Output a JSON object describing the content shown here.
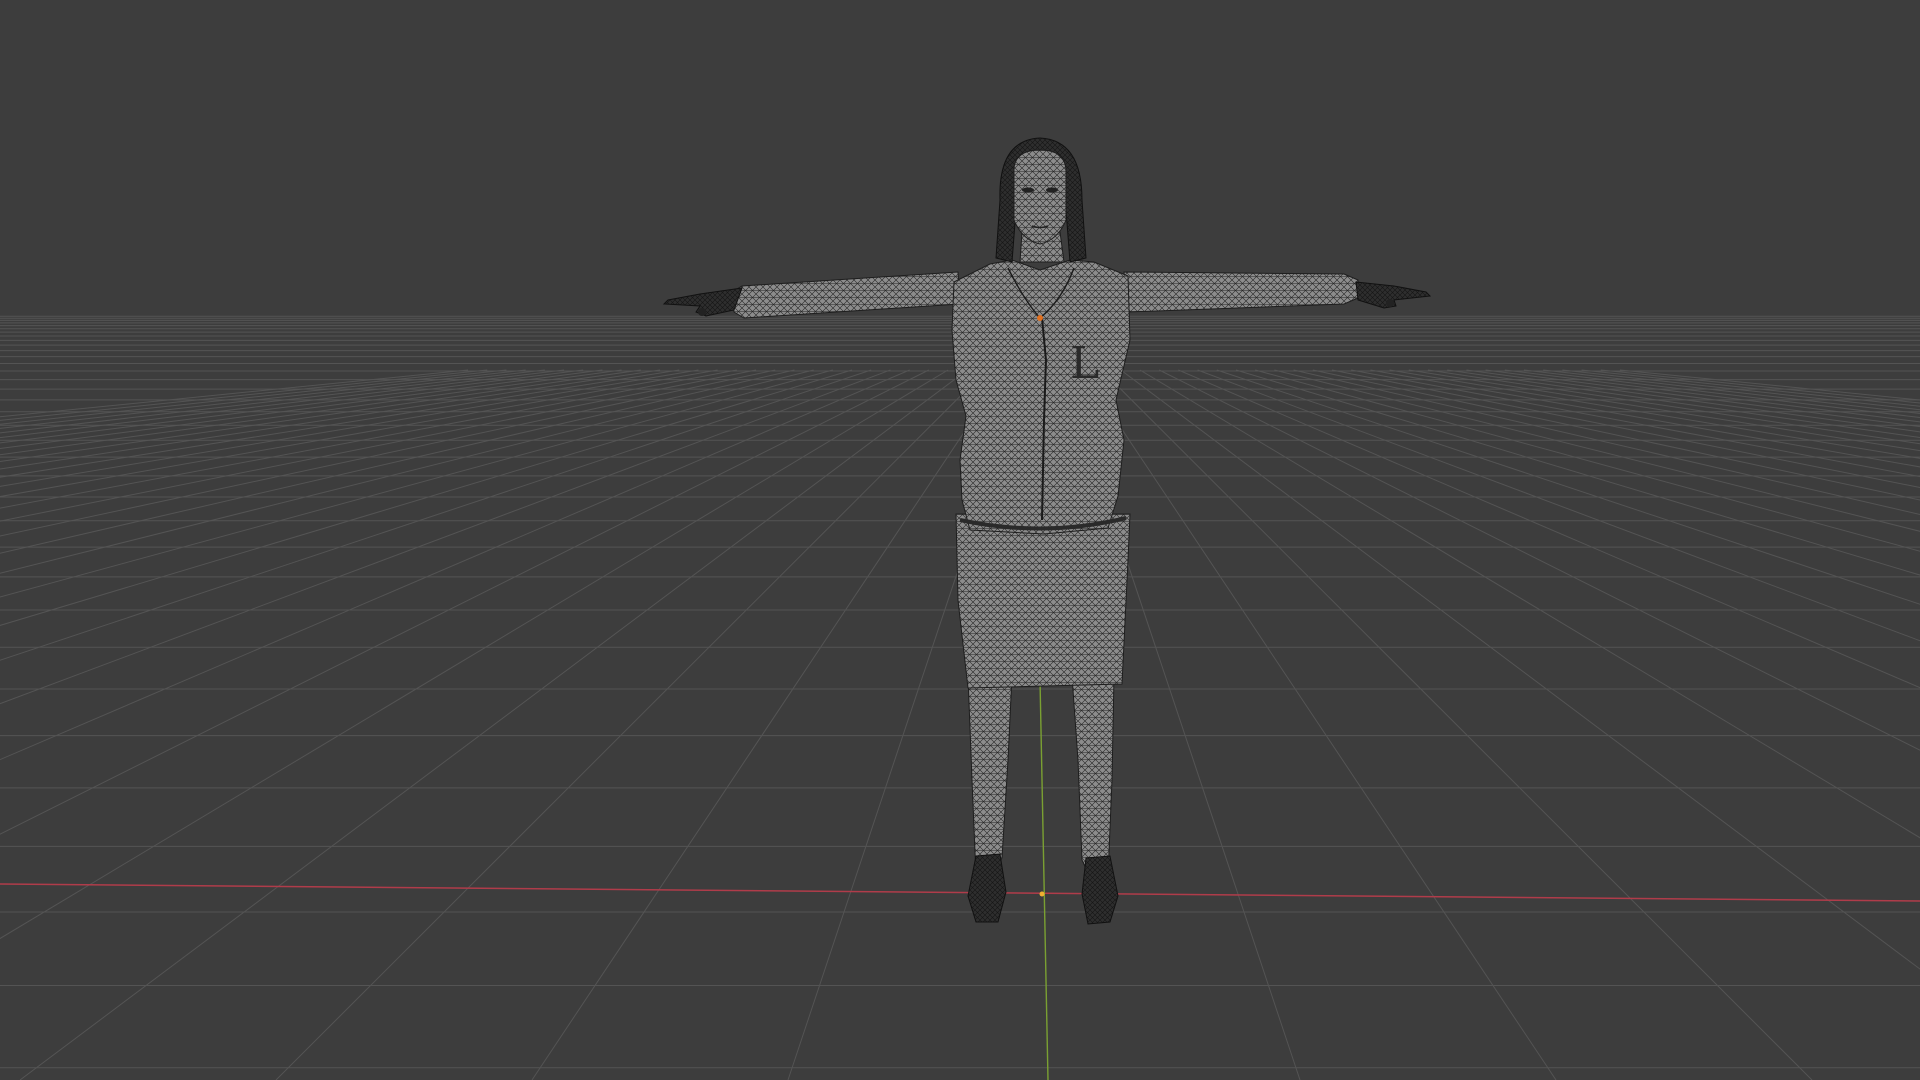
{
  "viewport": {
    "view": "front",
    "shading": "wireframe",
    "background_color": "#3d3d3d",
    "grid_color": "#545454",
    "x_axis_color": "#b03c4a",
    "y_axis_color": "#7aa032",
    "wire_color": "#1e1e1e",
    "fill_color": "#8a8a8a",
    "origin_marker_color": "#f0b030",
    "object_origin_color": "#e07020"
  },
  "scene_object": {
    "type": "character-mesh",
    "pose": "t-pose",
    "garment_letter": "L"
  }
}
